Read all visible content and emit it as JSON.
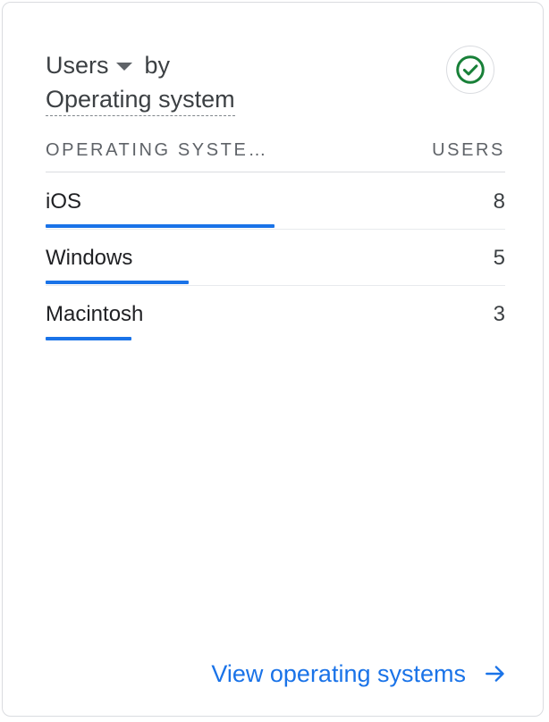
{
  "card": {
    "title": {
      "metric": "Users",
      "by": "by",
      "dimension": "Operating system"
    },
    "status_icon": "check-circle-icon",
    "status_color": "#188038"
  },
  "table": {
    "headers": {
      "dimension": "OPERATING SYSTE…",
      "metric": "USERS"
    },
    "max_value": 8,
    "rows": [
      {
        "label": "iOS",
        "value": "8",
        "bar_fraction": 1.0
      },
      {
        "label": "Windows",
        "value": "5",
        "bar_fraction": 0.625
      },
      {
        "label": "Macintosh",
        "value": "3",
        "bar_fraction": 0.375
      }
    ],
    "bar_color": "#1a73e8"
  },
  "footer": {
    "link_label": "View operating systems",
    "link_icon": "arrow-right-icon",
    "link_color": "#1a73e8"
  }
}
